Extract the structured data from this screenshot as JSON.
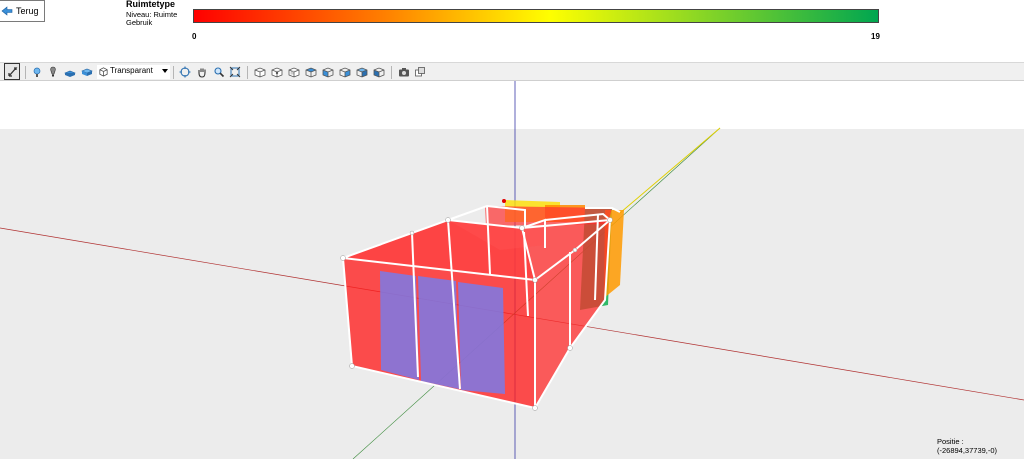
{
  "header": {
    "back_label": "Terug",
    "legend_title": "Ruimtetype",
    "legend_line1": "Niveau:  Ruimte",
    "legend_line2": "Gebruik",
    "min_value": "0",
    "max_value": "19"
  },
  "toolbar": {
    "display_mode": "Transparant",
    "icons": [
      "select-arrow-icon",
      "light-icon",
      "light-bulb-icon",
      "floor-icon",
      "box-icon",
      "orbit-icon",
      "pan-hand-icon",
      "zoom-icon",
      "zoom-extents-icon",
      "view-cube-icon",
      "camera-icon",
      "export-icon"
    ]
  },
  "status": {
    "position": "Positie : (-26894,37739,-0)"
  },
  "colors": {
    "grad_start": "#ff0000",
    "grad_mid1": "#ff8000",
    "grad_mid2": "#ffff00",
    "grad_end": "#00a650",
    "room_red": "#ff2020",
    "window_blue": "#7070e0",
    "axis_x": "#cc0000",
    "axis_y": "#008000",
    "axis_z": "#0000a0"
  }
}
